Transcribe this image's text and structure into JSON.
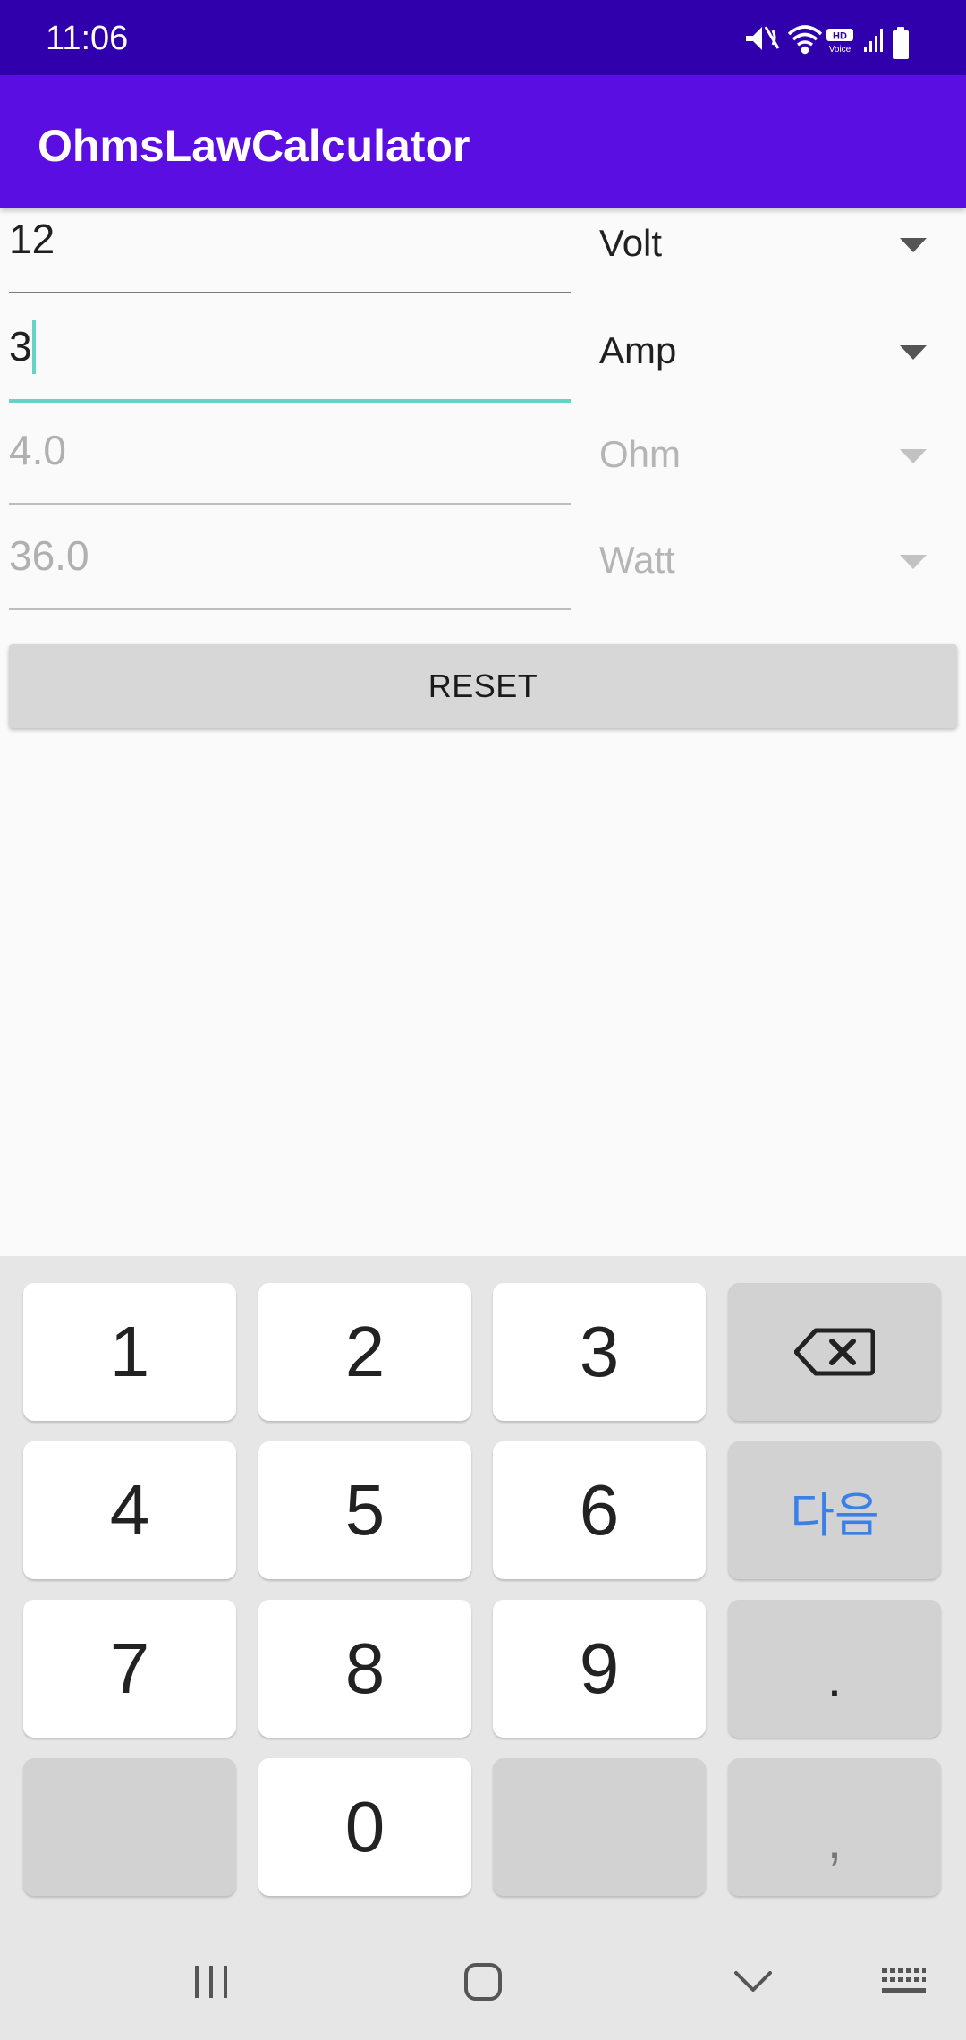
{
  "status": {
    "time": "11:06",
    "hd_badge": "HD",
    "voice_label": "Voice"
  },
  "app": {
    "title": "OhmsLawCalculator"
  },
  "fields": [
    {
      "value": "12",
      "unit": "Volt"
    },
    {
      "value": "3",
      "unit": "Amp"
    },
    {
      "value": "4.0",
      "unit": "Ohm"
    },
    {
      "value": "36.0",
      "unit": "Watt"
    }
  ],
  "reset_label": "RESET",
  "keyboard": {
    "keys": [
      "1",
      "2",
      "3",
      "4",
      "5",
      "6",
      "7",
      "8",
      "9",
      "0"
    ],
    "next_label": "다음",
    "dot_label": ".",
    "comma_label": ","
  },
  "colors": {
    "status_bar": "#3100ad",
    "app_bar": "#5a0ee2",
    "focus_accent": "#66d4c4",
    "next_key": "#3a80e8"
  }
}
